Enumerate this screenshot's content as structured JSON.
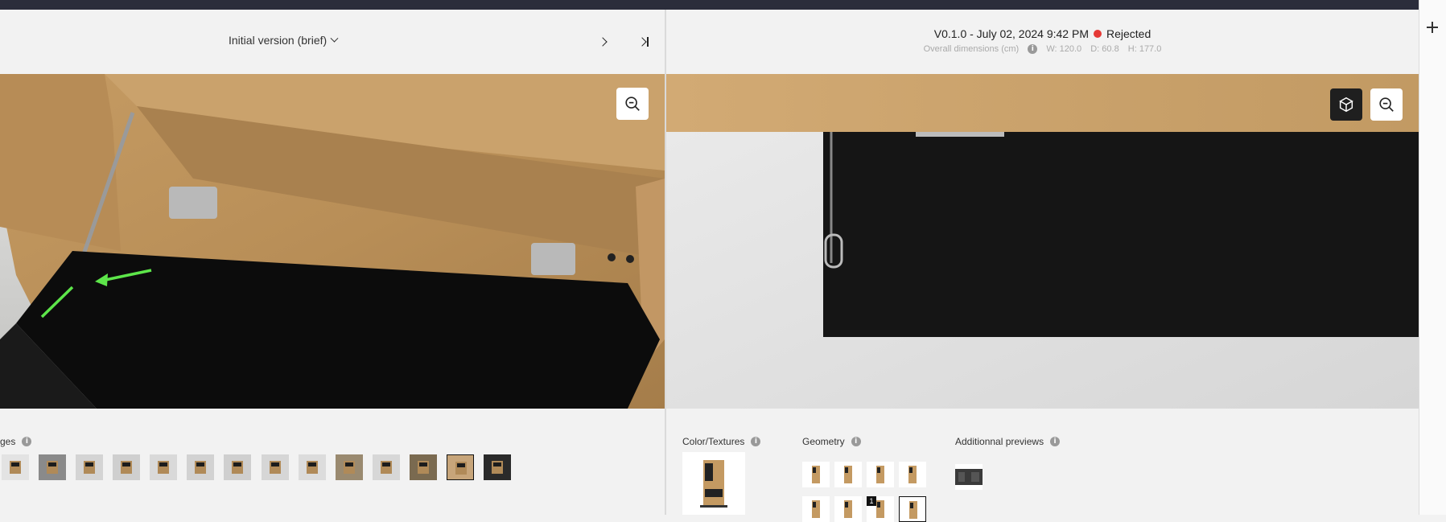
{
  "left": {
    "version_label": "Initial version (brief)",
    "images_label": "ges",
    "thumbnails": [
      "t1",
      "t2",
      "t3",
      "t4",
      "t5",
      "t6",
      "t7",
      "t8",
      "t9",
      "t10",
      "t11",
      "t12",
      "t13",
      "t14"
    ],
    "selected_thumbnail_index": 12
  },
  "right": {
    "version_title": "V0.1.0 - July 02, 2024 9:42 PM",
    "status": "Rejected",
    "status_color": "#e53935",
    "dims_label": "Overall dimensions (cm)",
    "width": "W: 120.0",
    "depth": "D: 60.8",
    "height": "H: 177.0",
    "color_textures_label": "Color/Textures",
    "geometry_label": "Geometry",
    "additional_previews_label": "Additionnal previews",
    "geometry_badge": "1",
    "info_glyph": "i"
  },
  "icons": {
    "zoom_out": "zoom-out-icon",
    "cube": "cube-icon",
    "plus": "plus-icon"
  }
}
